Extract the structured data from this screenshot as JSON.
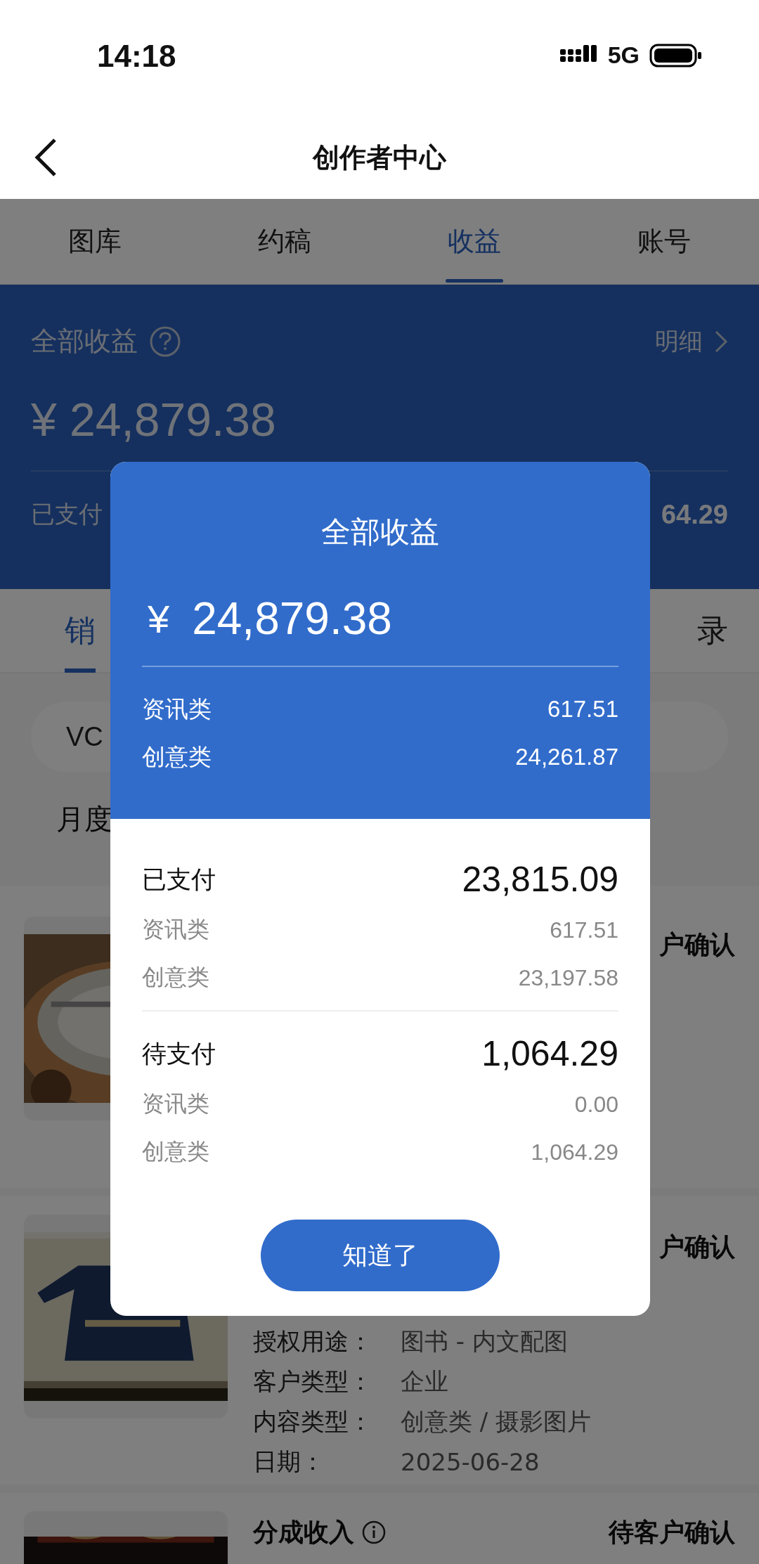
{
  "status_bar": {
    "time": "14:18",
    "network": "5G"
  },
  "header": {
    "title": "创作者中心"
  },
  "tabs": [
    {
      "label": "图库",
      "selected": false
    },
    {
      "label": "约稿",
      "selected": false
    },
    {
      "label": "收益",
      "selected": true
    },
    {
      "label": "账号",
      "selected": false
    }
  ],
  "earnings_summary": {
    "title": "全部收益",
    "detail_link": "明细",
    "total": "¥ 24,879.38",
    "paid_label": "已支付",
    "pending_amount": "64.29"
  },
  "sub_tabs": [
    {
      "label": "销",
      "selected": true
    },
    {
      "label": "录",
      "selected": false
    }
  ],
  "search": {
    "value": "VC"
  },
  "filter_label": "月度",
  "sales": [
    {
      "kind": "picture",
      "status": "户确认"
    },
    {
      "kind": "picture",
      "status": "户确认",
      "details": [
        {
          "label": "授权用途：",
          "value": "图书 - 内文配图"
        },
        {
          "label": "客户类型：",
          "value": "企业"
        },
        {
          "label": "内容类型：",
          "value": "创意类 / 摄影图片"
        },
        {
          "label": "日期：",
          "value": "2025-06-28"
        }
      ]
    },
    {
      "kind": "picture",
      "title": "分成收入",
      "status": "待客户确认"
    }
  ],
  "dialog": {
    "title": "全部收益",
    "currency": "¥",
    "total": "24,879.38",
    "breakdown": [
      {
        "label": "资讯类",
        "value": "617.51"
      },
      {
        "label": "创意类",
        "value": "24,261.87"
      }
    ],
    "sections": [
      {
        "label": "已支付",
        "amount": "23,815.09",
        "items": [
          {
            "label": "资讯类",
            "value": "617.51"
          },
          {
            "label": "创意类",
            "value": "23,197.58"
          }
        ]
      },
      {
        "label": "待支付",
        "amount": "1,064.29",
        "items": [
          {
            "label": "资讯类",
            "value": "0.00"
          },
          {
            "label": "创意类",
            "value": "1,064.29"
          }
        ]
      }
    ],
    "button": "知道了"
  }
}
